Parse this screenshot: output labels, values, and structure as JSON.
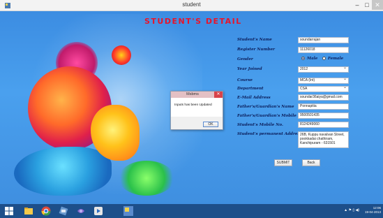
{
  "window": {
    "title": "student",
    "minimize": "–",
    "maximize": "□",
    "close": "✕"
  },
  "heading": "STUDENT'S DETAIL",
  "form": {
    "student_name": {
      "label": "Student's Name",
      "value": "soundarrajan"
    },
    "register_number": {
      "label": "Register Number",
      "value": "11126018"
    },
    "gender": {
      "label": "Gender",
      "options": [
        "Male",
        "Female"
      ],
      "selected": "Male"
    },
    "year_joined": {
      "label": "Year Joined",
      "value": "2012"
    },
    "course": {
      "label": "Course",
      "value": "MCA (Int)"
    },
    "department": {
      "label": "Department",
      "value": "CSA"
    },
    "email": {
      "label": "E-Mail Address",
      "value": "soundar36aiya@gmail.com"
    },
    "father_name": {
      "label": "Father's/Guardian's Name",
      "value": "Ponnapitia"
    },
    "father_mobile": {
      "label": "Father's/Guardian's Mobile No.",
      "value": "9500501435"
    },
    "student_mobile": {
      "label": "Student's Mobile No.",
      "value": "8124249060"
    },
    "address": {
      "label": "Student's permanent Address",
      "value": "26B, Kuppu navalvan Street, pookkadai chathiram, Kanchipuram - 631501"
    }
  },
  "buttons": {
    "submit": "SUBMIT",
    "back": "Back"
  },
  "dialog": {
    "title": "Msbms",
    "message": "Inputs has been Updated",
    "ok": "OK",
    "close": "✕"
  },
  "taskbar": {
    "tray_icons": "▲ ⚑ ▯ ◀)",
    "time": "12:06",
    "date": "19-04-2013"
  },
  "colors": {
    "heading": "#e8142a",
    "label": "#0b1d5a",
    "taskbar": "#1d4f8a"
  }
}
